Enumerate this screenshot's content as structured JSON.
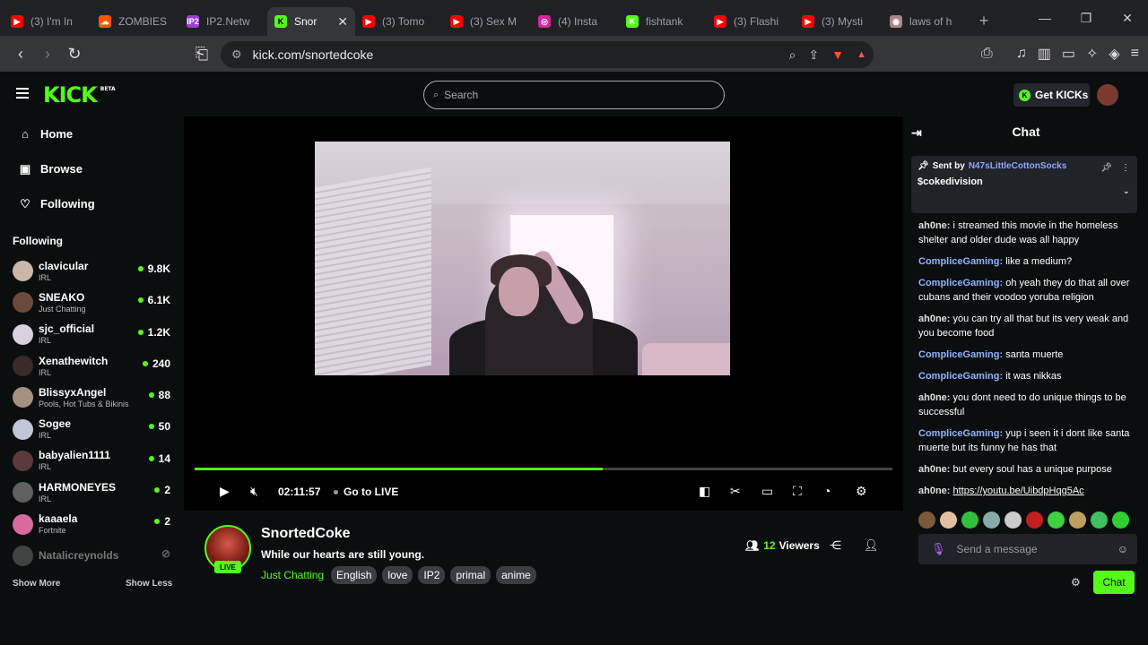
{
  "browser": {
    "tabs": [
      {
        "title": "(3) I'm In",
        "color": "#ff0000",
        "glyph": "▶"
      },
      {
        "title": "ZOMBIES",
        "color": "#ff5500",
        "glyph": "☁"
      },
      {
        "title": "IP2.Netw",
        "color": "#9a3dd6",
        "glyph": "IP2"
      },
      {
        "title": "Snor",
        "color": "#53fc18",
        "glyph": "K",
        "active": true
      },
      {
        "title": "(3) Tomo",
        "color": "#ff0000",
        "glyph": "▶"
      },
      {
        "title": "(3) Sex M",
        "color": "#ff0000",
        "glyph": "▶"
      },
      {
        "title": "(4) Insta",
        "color": "#d6249f",
        "glyph": "◎"
      },
      {
        "title": "fishtank",
        "color": "#53fc18",
        "glyph": "K"
      },
      {
        "title": "(3) Flashi",
        "color": "#ff0000",
        "glyph": "▶"
      },
      {
        "title": "(3) Mysti",
        "color": "#ff0000",
        "glyph": "▶"
      },
      {
        "title": "laws of h",
        "color": "#a88",
        "glyph": "◉"
      }
    ],
    "url": "kick.com/snortedcoke"
  },
  "header": {
    "logo": "KICK",
    "beta": "BETA",
    "search_placeholder": "Search",
    "get_kicks": "Get KICKs"
  },
  "sidebar": {
    "nav": [
      {
        "label": "Home",
        "icon": "home-icon",
        "glyph": "⌂"
      },
      {
        "label": "Browse",
        "icon": "browse-icon",
        "glyph": "▣"
      },
      {
        "label": "Following",
        "icon": "heart-icon",
        "glyph": "♡"
      }
    ],
    "following_title": "Following",
    "following": [
      {
        "name": "clavicular",
        "sub": "IRL",
        "count": "9.8K",
        "color": "#c9b8a8"
      },
      {
        "name": "SNEAKO",
        "sub": "Just Chatting",
        "count": "6.1K",
        "color": "#6a4a3a"
      },
      {
        "name": "sjc_official",
        "sub": "IRL",
        "count": "1.2K",
        "color": "#d9d0e0"
      },
      {
        "name": "Xenathewitch",
        "sub": "IRL",
        "count": "240",
        "color": "#3a2a2a"
      },
      {
        "name": "BlissyxAngel",
        "sub": "Pools, Hot Tubs & Bikinis",
        "count": "88",
        "color": "#a89080"
      },
      {
        "name": "Sogee",
        "sub": "IRL",
        "count": "50",
        "color": "#c0c8d8"
      },
      {
        "name": "babyalien1111",
        "sub": "IRL",
        "count": "14",
        "color": "#5a3a3a"
      },
      {
        "name": "HARMONEYES",
        "sub": "IRL",
        "count": "2",
        "color": "#606060"
      },
      {
        "name": "kaaaela",
        "sub": "Fortnite",
        "count": "2",
        "color": "#d86aa0"
      },
      {
        "name": "Natalicreynolds",
        "sub": "",
        "count": "",
        "color": "#777",
        "offline": true
      }
    ],
    "show_more": "Show More",
    "show_less": "Show Less"
  },
  "player": {
    "progress": 0.585,
    "time": "02:11:57",
    "go_live": "Go to LIVE"
  },
  "channel": {
    "name": "SnortedCoke",
    "live_badge": "LIVE",
    "title": "While our hearts are still young.",
    "category": "Just Chatting",
    "tags": [
      "English",
      "love",
      "IP2",
      "primal",
      "anime"
    ],
    "viewers_count": "12",
    "viewers_label": "Viewers"
  },
  "chat": {
    "title": "Chat",
    "pinned": {
      "sent_by": "Sent by",
      "sender": "N47sLittleCottonSocks",
      "message": "$cokedivision"
    },
    "messages": [
      {
        "user": "ah0ne",
        "type": "a",
        "text": " i streamed this movie in the homeless shelter and older dude was all happy"
      },
      {
        "user": "CompliceGaming",
        "type": "c",
        "text": " like a medium?"
      },
      {
        "user": "CompliceGaming",
        "type": "c",
        "text": " oh yeah they do that all over cubans and their voodoo yoruba religion"
      },
      {
        "user": "ah0ne",
        "type": "a",
        "text": " you can try all that but its very weak and you become food"
      },
      {
        "user": "CompliceGaming",
        "type": "c",
        "text": " santa muerte"
      },
      {
        "user": "CompliceGaming",
        "type": "c",
        "text": " it was nikkas"
      },
      {
        "user": "ah0ne",
        "type": "a",
        "text": " you dont need to do unique things to be successful"
      },
      {
        "user": "CompliceGaming",
        "type": "c",
        "text": " yup i seen it i dont like santa muerte but its funny he has that"
      },
      {
        "user": "ah0ne",
        "type": "a",
        "text": " but every soul has a unique purpose"
      },
      {
        "user": "ah0ne",
        "type": "a",
        "link": "https://youtu.be/UibdpHqg5Ac"
      }
    ],
    "emotes": [
      "#7a5a3a",
      "#e0c0a0",
      "#30c040",
      "#8aa",
      "#ccc",
      "#c02020",
      "#40d040",
      "#c0a060",
      "#40c060",
      "#30d030"
    ],
    "input_placeholder": "Send a message",
    "send_label": "Chat"
  }
}
